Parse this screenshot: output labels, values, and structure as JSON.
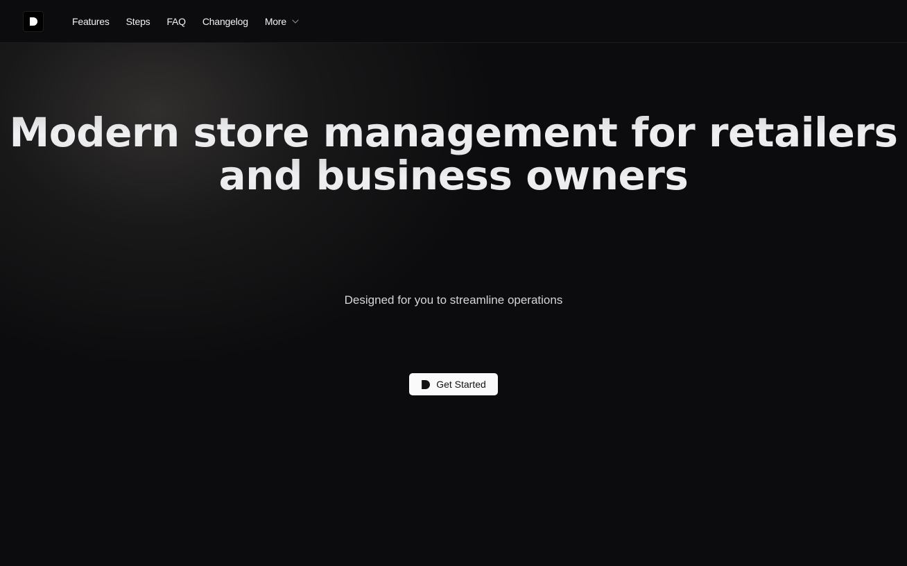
{
  "nav": {
    "logo_icon": "brand-d-logo-icon",
    "links": [
      "Features",
      "Steps",
      "FAQ",
      "Changelog"
    ],
    "more_label": "More",
    "more_icon": "chevron-down-icon"
  },
  "hero": {
    "title": "Modern store management for retailers and business owners",
    "subtitle": "Designed for you to streamline operations",
    "cta_label": "Get Started",
    "cta_icon": "brand-d-logo-icon"
  },
  "colors": {
    "background": "#0c0c0e",
    "text": "#f2f2f2",
    "cta_background": "#fafafa"
  }
}
